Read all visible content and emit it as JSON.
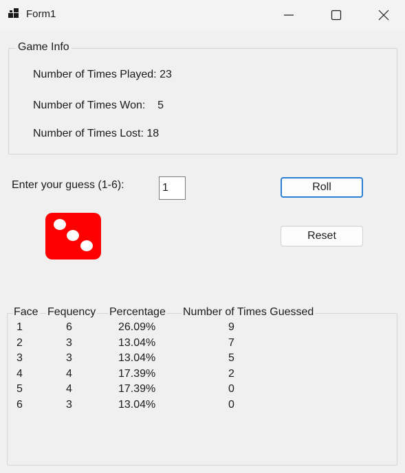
{
  "window": {
    "title": "Form1",
    "icons": {
      "app": "winforms-app-icon",
      "minimize": "minimize-icon",
      "maximize": "maximize-icon",
      "close": "close-icon"
    }
  },
  "game_info": {
    "legend": "Game Info",
    "played": "Number of Times Played: 23",
    "won": "Number of Times Won:    5",
    "lost": "Number of Times Lost: 18"
  },
  "guess": {
    "label": "Enter your guess (1-6):",
    "value": "1"
  },
  "buttons": {
    "roll": "Roll",
    "reset": "Reset"
  },
  "die": {
    "face": 3,
    "color": "#ff0000",
    "pip_color": "#ffffff"
  },
  "stats": {
    "headers": [
      "Face",
      "Fequency",
      "Percentage",
      "Number of Times Guessed"
    ],
    "rows": [
      [
        "1",
        "6",
        "26.09%",
        "9"
      ],
      [
        "2",
        "3",
        "13.04%",
        "7"
      ],
      [
        "3",
        "3",
        "13.04%",
        "5"
      ],
      [
        "4",
        "4",
        "17.39%",
        "2"
      ],
      [
        "5",
        "4",
        "17.39%",
        "0"
      ],
      [
        "6",
        "3",
        "13.04%",
        "0"
      ]
    ]
  },
  "colors": {
    "accent": "#2a7fd4",
    "background": "#f0f0f0",
    "group_border": "#d4d4d4"
  }
}
